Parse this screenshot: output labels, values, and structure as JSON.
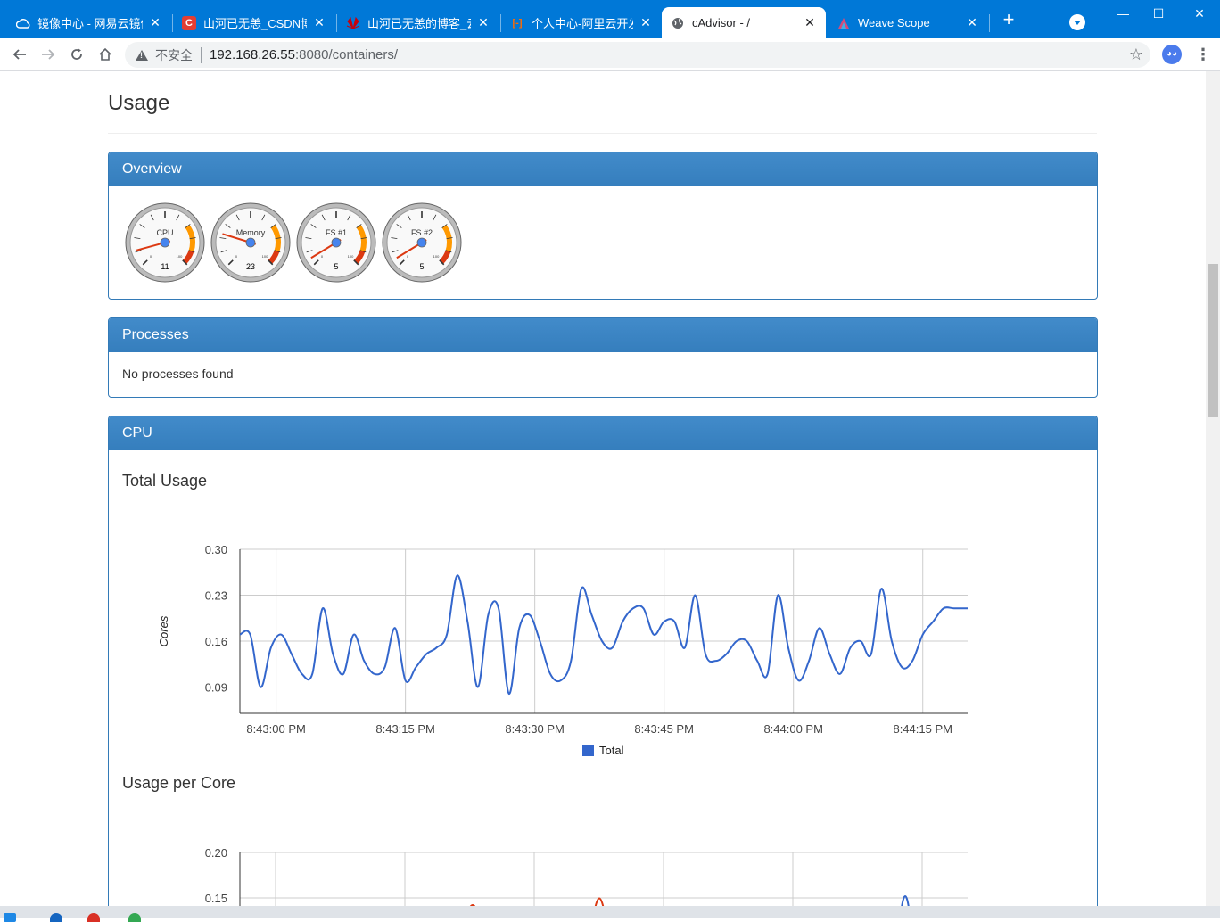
{
  "browser": {
    "tabs": [
      {
        "title": "镜像中心 - 网易云镜像",
        "icon": "cloud-icon",
        "active": false
      },
      {
        "title": "山河已无恙_CSDN博客",
        "icon": "csdn-icon",
        "active": false
      },
      {
        "title": "山河已无恙的博客_云",
        "icon": "huawei-icon",
        "active": false
      },
      {
        "title": "个人中心-阿里云开发",
        "icon": "aliyun-icon",
        "active": false
      },
      {
        "title": "cAdvisor - /",
        "icon": "globe-icon",
        "active": true
      },
      {
        "title": "Weave Scope",
        "icon": "weave-icon",
        "active": false
      }
    ],
    "new_tab": "+",
    "insecure_label": "不安全",
    "url_host": "192.168.26.55",
    "url_rest": ":8080/containers/"
  },
  "page": {
    "title": "Usage",
    "overview": {
      "heading": "Overview",
      "gauges": [
        {
          "label": "CPU",
          "value": 11
        },
        {
          "label": "Memory",
          "value": 23
        },
        {
          "label": "FS #1",
          "value": 5
        },
        {
          "label": "FS #2",
          "value": 5
        }
      ],
      "gauge_scale": {
        "min": "0",
        "max": "100"
      }
    },
    "processes": {
      "heading": "Processes",
      "empty_text": "No processes found"
    },
    "cpu": {
      "heading": "CPU",
      "total_usage_title": "Total Usage",
      "per_core_title": "Usage per Core"
    }
  },
  "colors": {
    "panel_heading": "#428bca",
    "series_total": "#3366cc",
    "series_core2": "#dc3912",
    "browser_accent": "#0078d7"
  },
  "chart_data": [
    {
      "type": "line",
      "title": "Total Usage",
      "ylabel": "Cores",
      "xlabel": "",
      "ylim": [
        0.05,
        0.3
      ],
      "yticks": [
        "0.30",
        "0.23",
        "0.16",
        "0.09"
      ],
      "xticks": [
        "8:43:00 PM",
        "8:43:15 PM",
        "8:43:30 PM",
        "8:43:45 PM",
        "8:44:00 PM",
        "8:44:15 PM"
      ],
      "x_range_seconds": [
        -4.2,
        80.2
      ],
      "legend_position": "bottom",
      "grid": true,
      "series": [
        {
          "name": "Total",
          "color": "#3366cc",
          "x": [
            -4.2,
            -3.0,
            -1.8,
            -0.6,
            0.6,
            1.8,
            3.0,
            4.2,
            5.4,
            6.6,
            7.8,
            9.0,
            10.2,
            11.4,
            12.6,
            13.8,
            15.0,
            16.2,
            17.4,
            18.6,
            19.8,
            21.0,
            22.2,
            23.4,
            24.6,
            25.8,
            27.0,
            28.2,
            29.4,
            30.6,
            31.8,
            33.0,
            34.2,
            35.4,
            36.6,
            37.8,
            39.0,
            40.2,
            41.4,
            42.6,
            43.8,
            45.0,
            46.2,
            47.4,
            48.6,
            49.8,
            51.0,
            52.2,
            53.4,
            54.6,
            55.8,
            57.0,
            58.2,
            59.4,
            60.6,
            61.8,
            63.0,
            64.2,
            65.4,
            66.6,
            67.8,
            69.0,
            70.2,
            71.4,
            72.6,
            73.8,
            75.0,
            76.2,
            77.4,
            78.6,
            79.8,
            80.2
          ],
          "y": [
            0.17,
            0.17,
            0.09,
            0.15,
            0.17,
            0.14,
            0.11,
            0.11,
            0.21,
            0.14,
            0.11,
            0.17,
            0.13,
            0.11,
            0.12,
            0.18,
            0.1,
            0.12,
            0.14,
            0.15,
            0.17,
            0.26,
            0.19,
            0.09,
            0.2,
            0.21,
            0.08,
            0.18,
            0.2,
            0.16,
            0.11,
            0.1,
            0.13,
            0.24,
            0.2,
            0.16,
            0.15,
            0.19,
            0.21,
            0.21,
            0.17,
            0.19,
            0.19,
            0.15,
            0.23,
            0.14,
            0.13,
            0.14,
            0.16,
            0.16,
            0.13,
            0.11,
            0.23,
            0.15,
            0.1,
            0.13,
            0.18,
            0.14,
            0.11,
            0.15,
            0.16,
            0.14,
            0.24,
            0.16,
            0.12,
            0.13,
            0.17,
            0.19,
            0.21,
            0.21,
            0.21,
            0.21
          ]
        }
      ]
    },
    {
      "type": "line",
      "title": "Usage per Core",
      "ylabel": "",
      "xlabel": "",
      "ylim": [
        0.1,
        0.2
      ],
      "yticks": [
        "0.20",
        "0.15"
      ],
      "series": []
    }
  ]
}
